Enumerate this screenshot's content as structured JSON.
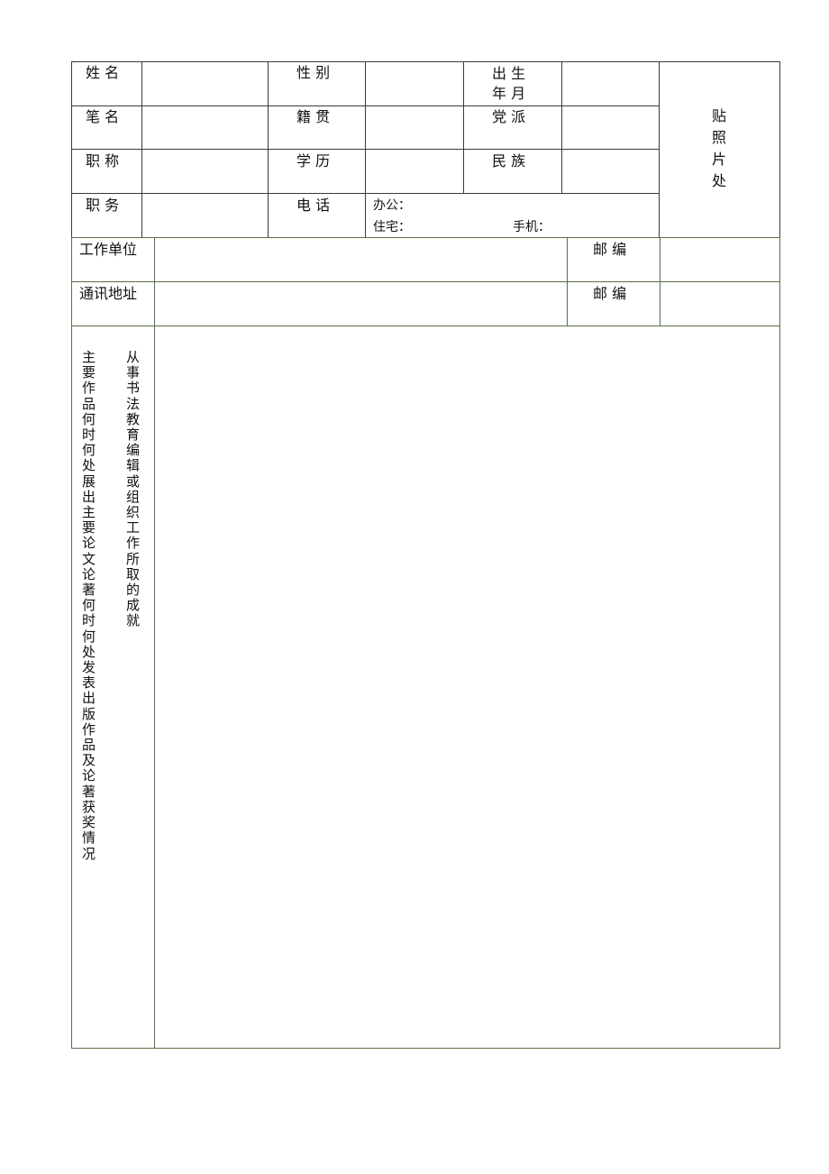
{
  "form": {
    "row1": {
      "name": "姓  名",
      "gender": "性 别",
      "birth_line1": "出  生",
      "birth_line2": "年  月"
    },
    "row2": {
      "pen_name": "笔  名",
      "native_place": "籍 贯",
      "party": "党 派"
    },
    "row3": {
      "title": "职  称",
      "education": "学 历",
      "ethnicity": "民 族"
    },
    "row4": {
      "position": "职  务",
      "phone": "电 话",
      "office": "办公：",
      "home": "住宅：",
      "mobile": "手机："
    },
    "photo": [
      "贴",
      "照",
      "片",
      "处"
    ],
    "work_unit": "工作单位",
    "address": "通讯地址",
    "postcode1": "邮 编",
    "postcode2": "邮 编",
    "works_label_col1": "主要作品何时何处展出 主要论文 论著何时何处发表 出版 作品及论著获奖情况",
    "works_label_col2": "从事书法教育 编辑或组织工作所取的成就"
  }
}
